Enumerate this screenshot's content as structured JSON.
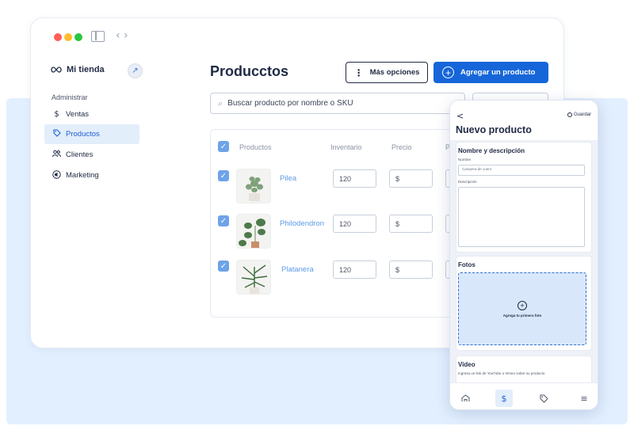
{
  "window": {
    "traffic_colors": [
      "#ff5f57",
      "#febc2e",
      "#28c840"
    ]
  },
  "sidebar": {
    "store_name": "Mi tienda",
    "section_label": "Administrar",
    "items": [
      {
        "label": "Ventas",
        "icon": "dollar-icon"
      },
      {
        "label": "Productos",
        "icon": "tag-icon",
        "active": true
      },
      {
        "label": "Clientes",
        "icon": "users-icon"
      },
      {
        "label": "Marketing",
        "icon": "megaphone-icon"
      }
    ]
  },
  "main": {
    "title": "Producctos",
    "more_button": "Más opciones",
    "add_button": "Agregar un producto",
    "search_placeholder": "Buscar producto por nombre o SKU",
    "columns": [
      "Productos",
      "Inventario",
      "Precio",
      "P"
    ],
    "rows": [
      {
        "name": "Pilea",
        "inventory": "120",
        "price": "$",
        "checked": true
      },
      {
        "name": "Philodendron",
        "inventory": "120",
        "price": "$",
        "checked": true
      },
      {
        "name": "Platanera",
        "inventory": "120",
        "price": "$",
        "checked": true
      }
    ]
  },
  "mobile": {
    "back": "<",
    "save": "Guardar",
    "title": "Nuevo producto",
    "section_name_desc": "Nombre y descripción",
    "name_label": "Nombre",
    "name_value": "Campera de cuero",
    "description_label": "Descripción",
    "photos_title": "Fotos",
    "photos_cta": "Agrega tu primera foto",
    "video_title": "Video",
    "video_hint": "Ingresa un link de YouTube o Vimeo sobre su producto",
    "tabs": [
      "home-icon",
      "dollar-icon",
      "tag-icon",
      "menu-icon"
    ]
  },
  "colors": {
    "accent": "#1666d9",
    "active_bg": "#e3eefb",
    "band_bg": "#e2efff"
  }
}
